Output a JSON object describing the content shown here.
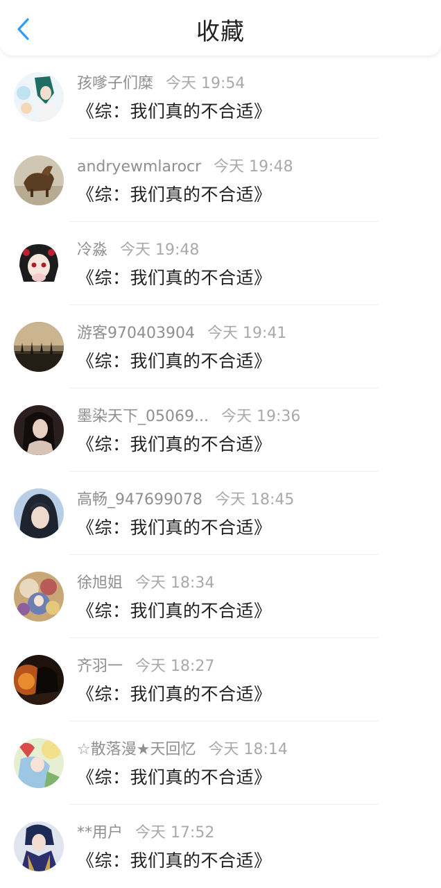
{
  "header": {
    "title": "收藏",
    "back_icon": "chevron-left-icon",
    "accent_color": "#2d9cff"
  },
  "items": [
    {
      "username": "孩嗲子们糜",
      "time": "今天 19:54",
      "title": "《综：我们真的不合适》"
    },
    {
      "username": "andryewmlarocr",
      "time": "今天 19:48",
      "title": "《综：我们真的不合适》"
    },
    {
      "username": "冷淼",
      "time": "今天 19:48",
      "title": "《综：我们真的不合适》"
    },
    {
      "username": "游客970403904",
      "time": "今天 19:41",
      "title": "《综：我们真的不合适》"
    },
    {
      "username": "墨染天下_05069...",
      "time": "今天 19:36",
      "title": "《综：我们真的不合适》"
    },
    {
      "username": "高畅_947699078",
      "time": "今天 18:45",
      "title": "《综：我们真的不合适》"
    },
    {
      "username": "徐旭姐",
      "time": "今天 18:34",
      "title": "《综：我们真的不合适》"
    },
    {
      "username": "齐羽一",
      "time": "今天 18:27",
      "title": "《综：我们真的不合适》"
    },
    {
      "username": "☆散落漫★天回忆",
      "time": "今天 18:14",
      "title": "《综：我们真的不合适》"
    },
    {
      "username": "**用户",
      "time": "今天 17:52",
      "title": "《综：我们真的不合适》"
    }
  ]
}
